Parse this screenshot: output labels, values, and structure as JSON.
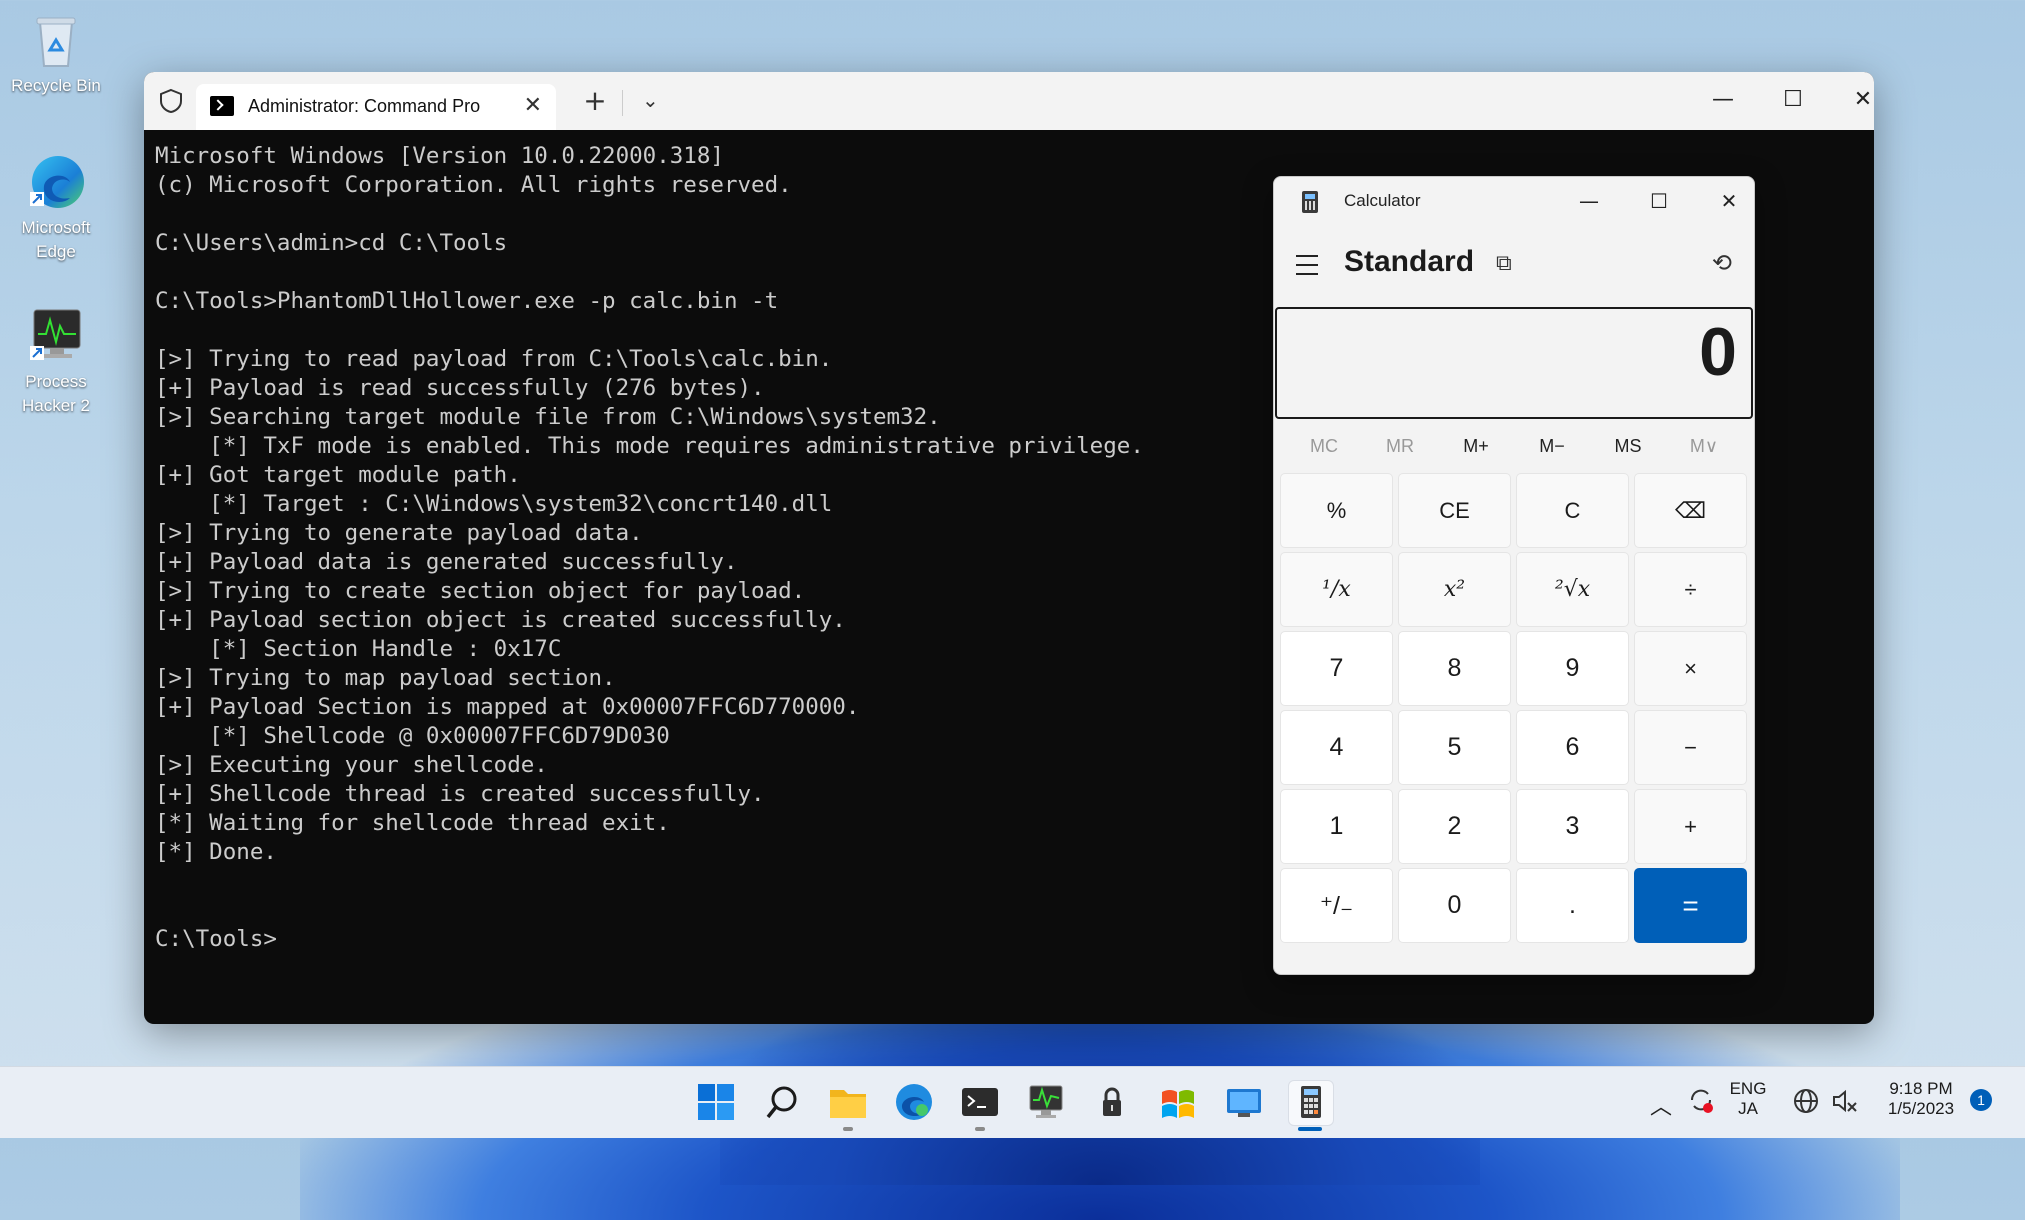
{
  "desktop": {
    "icons": [
      {
        "label": "Recycle Bin"
      },
      {
        "label": "Microsoft Edge"
      },
      {
        "label": "Process Hacker 2"
      }
    ]
  },
  "terminal": {
    "tab_title": "Administrator: Command Pro",
    "lines": [
      "Microsoft Windows [Version 10.0.22000.318]",
      "(c) Microsoft Corporation. All rights reserved.",
      "",
      "C:\\Users\\admin>cd C:\\Tools",
      "",
      "C:\\Tools>PhantomDllHollower.exe -p calc.bin -t",
      "",
      "[>] Trying to read payload from C:\\Tools\\calc.bin.",
      "[+] Payload is read successfully (276 bytes).",
      "[>] Searching target module file from C:\\Windows\\system32.",
      "    [*] TxF mode is enabled. This mode requires administrative privilege.",
      "[+] Got target module path.",
      "    [*] Target : C:\\Windows\\system32\\concrt140.dll",
      "[>] Trying to generate payload data.",
      "[+] Payload data is generated successfully.",
      "[>] Trying to create section object for payload.",
      "[+] Payload section object is created successfully.",
      "    [*] Section Handle : 0x17C",
      "[>] Trying to map payload section.",
      "[+] Payload Section is mapped at 0x00007FFC6D770000.",
      "    [*] Shellcode @ 0x00007FFC6D79D030",
      "[>] Executing your shellcode.",
      "[+] Shellcode thread is created successfully.",
      "[*] Waiting for shellcode thread exit.",
      "[*] Done.",
      "",
      "",
      "C:\\Tools>"
    ]
  },
  "calculator": {
    "title": "Calculator",
    "mode": "Standard",
    "display": "0",
    "memory": [
      "MC",
      "MR",
      "M+",
      "M−",
      "MS",
      "M∨"
    ],
    "keys": {
      "percent": "%",
      "ce": "CE",
      "c": "C",
      "backspace": "⌫",
      "reciprocal": "¹/x",
      "square": "x²",
      "sqrt": "²√x",
      "divide": "÷",
      "k7": "7",
      "k8": "8",
      "k9": "9",
      "multiply": "×",
      "k4": "4",
      "k5": "5",
      "k6": "6",
      "minus": "−",
      "k1": "1",
      "k2": "2",
      "k3": "3",
      "plus": "+",
      "negate": "⁺/₋",
      "k0": "0",
      "dot": ".",
      "equals": "="
    },
    "accent": "#005fb8"
  },
  "taskbar": {
    "lang_top": "ENG",
    "lang_bottom": "JA",
    "time": "9:18 PM",
    "date": "1/5/2023",
    "notification_count": "1"
  }
}
